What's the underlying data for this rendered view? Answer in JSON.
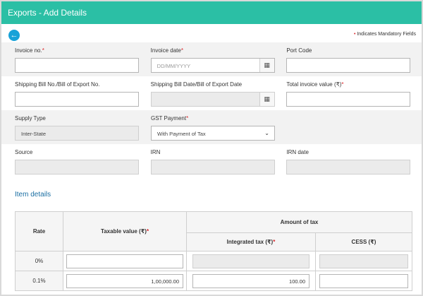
{
  "header": {
    "title": "Exports - Add Details"
  },
  "mandatory_note": "Indicates Mandatory Fields",
  "mandatory_marker": "•",
  "required_marker": "*",
  "row1": {
    "invoice_no": {
      "label": "Invoice no.",
      "value": ""
    },
    "invoice_date": {
      "label": "Invoice date",
      "placeholder": "DD/MM/YYYY"
    },
    "port_code": {
      "label": "Port Code",
      "value": ""
    }
  },
  "row2": {
    "shipping_bill_no": {
      "label": "Shipping Bill No./Bill of Export No.",
      "value": ""
    },
    "shipping_bill_date": {
      "label": "Shipping Bill Date/Bill of Export Date",
      "value": ""
    },
    "total_invoice_value": {
      "label": "Total invoice value (₹)",
      "value": ""
    }
  },
  "row3": {
    "supply_type": {
      "label": "Supply Type",
      "value": "Inter-State"
    },
    "gst_payment": {
      "label": "GST Payment",
      "selected": "With Payment of Tax"
    }
  },
  "row4": {
    "source": {
      "label": "Source",
      "value": ""
    },
    "irn": {
      "label": "IRN",
      "value": ""
    },
    "irn_date": {
      "label": "IRN date",
      "value": ""
    }
  },
  "item_details": {
    "title": "Item details",
    "headers": {
      "rate": "Rate",
      "taxable_value": "Taxable value (₹)",
      "amount_of_tax": "Amount of tax",
      "integrated_tax": "Integrated tax (₹)",
      "cess": "CESS (₹)"
    },
    "rows": [
      {
        "rate": "0%",
        "taxable_value": "",
        "integrated_tax": "",
        "cess": ""
      },
      {
        "rate": "0.1%",
        "taxable_value": "1,00,000.00",
        "integrated_tax": "100.00",
        "cess": ""
      }
    ]
  },
  "icons": {
    "back": "arrow-left-circle-icon",
    "calendar": "calendar-icon",
    "dropdown": "chevron-down-icon"
  },
  "colors": {
    "header_bg": "#2bbfa5",
    "accent_blue": "#17a2d8",
    "required_red": "#d9262a",
    "section_title": "#1b6fa3"
  }
}
